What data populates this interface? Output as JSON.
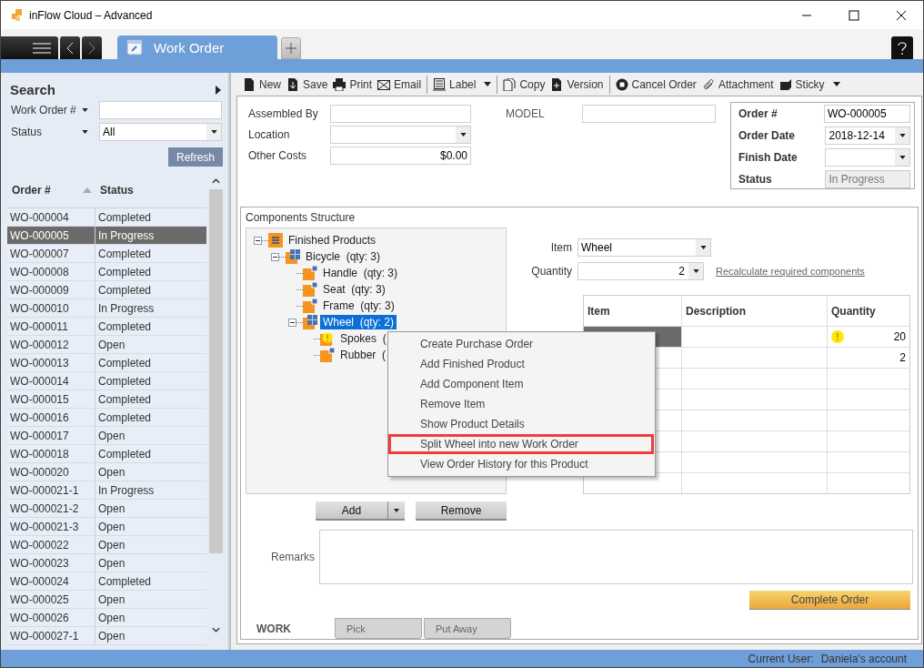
{
  "window": {
    "title": "inFlow Cloud – Advanced"
  },
  "tabs": [
    {
      "label": "Work Order",
      "selected": true
    }
  ],
  "search": {
    "title": "Search",
    "filters": [
      {
        "label": "Work Order #",
        "kind": "text"
      },
      {
        "label": "Status",
        "kind": "select",
        "value": "All"
      }
    ],
    "refresh": "Refresh"
  },
  "list": {
    "columns": [
      {
        "label": "Order #",
        "sorted": true
      },
      {
        "label": "Status",
        "sorted": false
      }
    ],
    "rows": [
      {
        "order": "WO-000004",
        "status": "Completed",
        "selected": false
      },
      {
        "order": "WO-000005",
        "status": "In Progress",
        "selected": true
      },
      {
        "order": "WO-000007",
        "status": "Completed",
        "selected": false
      },
      {
        "order": "WO-000008",
        "status": "Completed",
        "selected": false
      },
      {
        "order": "WO-000009",
        "status": "Completed",
        "selected": false
      },
      {
        "order": "WO-000010",
        "status": "In Progress",
        "selected": false
      },
      {
        "order": "WO-000011",
        "status": "Completed",
        "selected": false
      },
      {
        "order": "WO-000012",
        "status": "Open",
        "selected": false
      },
      {
        "order": "WO-000013",
        "status": "Completed",
        "selected": false
      },
      {
        "order": "WO-000014",
        "status": "Completed",
        "selected": false
      },
      {
        "order": "WO-000015",
        "status": "Completed",
        "selected": false
      },
      {
        "order": "WO-000016",
        "status": "Completed",
        "selected": false
      },
      {
        "order": "WO-000017",
        "status": "Open",
        "selected": false
      },
      {
        "order": "WO-000018",
        "status": "Completed",
        "selected": false
      },
      {
        "order": "WO-000020",
        "status": "Open",
        "selected": false
      },
      {
        "order": "WO-000021-1",
        "status": "In Progress",
        "selected": false
      },
      {
        "order": "WO-000021-2",
        "status": "Open",
        "selected": false
      },
      {
        "order": "WO-000021-3",
        "status": "Open",
        "selected": false
      },
      {
        "order": "WO-000022",
        "status": "Open",
        "selected": false
      },
      {
        "order": "WO-000023",
        "status": "Open",
        "selected": false
      },
      {
        "order": "WO-000024",
        "status": "Completed",
        "selected": false
      },
      {
        "order": "WO-000025",
        "status": "Open",
        "selected": false
      },
      {
        "order": "WO-000026",
        "status": "Open",
        "selected": false
      },
      {
        "order": "WO-000027-1",
        "status": "Open",
        "selected": false
      }
    ]
  },
  "toolbar": [
    [
      {
        "label": "New",
        "dropdown": false
      },
      {
        "label": "Save",
        "dropdown": false
      },
      {
        "label": "Print",
        "dropdown": false
      },
      {
        "label": "Email",
        "dropdown": false
      }
    ],
    [
      {
        "label": "Label",
        "dropdown": true
      }
    ],
    [
      {
        "label": "Copy",
        "dropdown": false
      },
      {
        "label": "Version",
        "dropdown": false
      }
    ],
    [
      {
        "label": "Cancel Order",
        "dropdown": false
      },
      {
        "label": "Attachment",
        "dropdown": false
      },
      {
        "label": "Sticky",
        "dropdown": true
      }
    ]
  ],
  "form": {
    "fields": [
      {
        "label": "Assembled By",
        "kind": "text"
      },
      {
        "label": "Location",
        "kind": "select"
      },
      {
        "label": "Other Costs",
        "kind": "text",
        "value": "$0.00"
      }
    ],
    "model": {
      "label": "MODEL"
    },
    "order": [
      {
        "label": "Order #",
        "kind": "text",
        "value": "WO-000005"
      },
      {
        "label": "Order Date",
        "kind": "select",
        "value": "2018-12-14"
      },
      {
        "label": "Finish Date",
        "kind": "select"
      },
      {
        "label": "Status",
        "kind": "readonly",
        "value": "In Progress"
      }
    ]
  },
  "components": {
    "title": "Components Structure",
    "tree": [
      {
        "label": "Finished Products",
        "kind": "root",
        "expanded": true,
        "selected": false,
        "children": [
          {
            "label": "Bicycle  (qty: 3)",
            "kind": "assembly",
            "expanded": true,
            "selected": false,
            "children": [
              {
                "label": "Handle  (qty: 3)",
                "kind": "part",
                "selected": false,
                "warning": false
              },
              {
                "label": "Seat  (qty: 3)",
                "kind": "part",
                "selected": false,
                "warning": false
              },
              {
                "label": "Frame  (qty: 3)",
                "kind": "part",
                "selected": false,
                "warning": false
              },
              {
                "label": "Wheel  (qty: 2)",
                "kind": "assembly",
                "expanded": true,
                "selected": true,
                "children": [
                  {
                    "label": "Spokes  (",
                    "kind": "part",
                    "selected": false,
                    "warning": true
                  },
                  {
                    "label": "Rubber  (",
                    "kind": "part",
                    "selected": false,
                    "warning": false
                  }
                ]
              }
            ]
          }
        ]
      }
    ],
    "item": {
      "label": "Item",
      "value": "Wheel"
    },
    "quantity": {
      "label": "Quantity",
      "value": "2"
    },
    "link": "Recalculate required components",
    "table": {
      "columns": [
        "Item",
        "Description",
        "Quantity"
      ],
      "rows": [
        {
          "selected": true,
          "quantity": "20",
          "warning": true
        },
        {
          "selected": false,
          "quantity": "2",
          "warning": false
        }
      ]
    },
    "add": "Add",
    "remove": "Remove"
  },
  "remarks": {
    "label": "Remarks"
  },
  "complete": "Complete Order",
  "bottom_tabs": [
    {
      "label": "WORK",
      "selected": true
    },
    {
      "label": "Pick",
      "selected": false
    },
    {
      "label": "Put Away",
      "selected": false
    }
  ],
  "context_menu": {
    "items": [
      {
        "label": "Create Purchase Order",
        "highlighted": false
      },
      {
        "label": "Add Finished Product",
        "highlighted": false
      },
      {
        "label": "Add Component Item",
        "highlighted": false
      },
      {
        "label": "Remove Item",
        "highlighted": false
      },
      {
        "label": "Show Product Details",
        "highlighted": false
      },
      {
        "label": "Split Wheel into new Work Order",
        "highlighted": true
      },
      {
        "label": "View Order History for this Product",
        "highlighted": false
      }
    ]
  },
  "status_bar": {
    "label": "Current User:",
    "user": "Daniela's account"
  }
}
